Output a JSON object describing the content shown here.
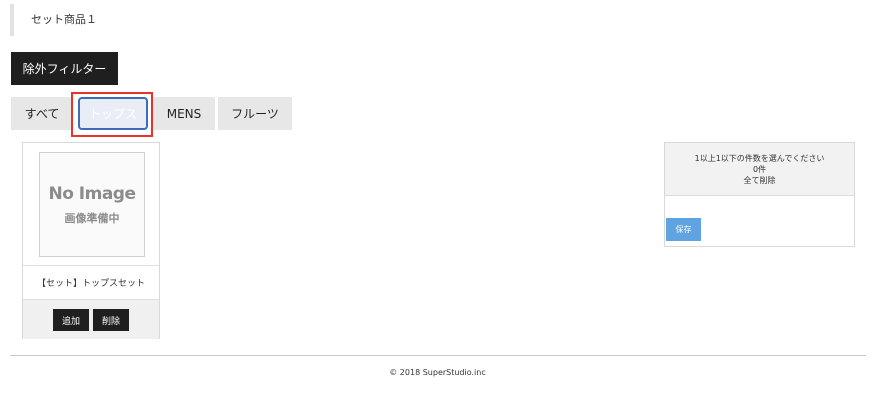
{
  "set": {
    "title": "セット商品１"
  },
  "filter": {
    "exclude_label": "除外フィルター"
  },
  "tabs": [
    {
      "label": "すべて"
    },
    {
      "label": "トップス"
    },
    {
      "label": "MENS"
    },
    {
      "label": "フルーツ"
    }
  ],
  "product": {
    "image": {
      "line1": "No Image",
      "line2": "画像準備中"
    },
    "name": "【セット】トップスセット",
    "add_label": "追加",
    "delete_label": "削除"
  },
  "selection": {
    "instruction": "1以上1以下の件数を選んでください",
    "count": "0件",
    "clear_all": "全て削除",
    "save_label": "保存"
  },
  "footer": {
    "copyright": "© 2018 SuperStudio.inc"
  },
  "colors": {
    "dark_button": "#1f1f1f",
    "tab_bg": "#e7e7e7",
    "active_tab_border": "#3e6db8",
    "highlight": "#e8322a",
    "save_button": "#5fa3e0"
  }
}
